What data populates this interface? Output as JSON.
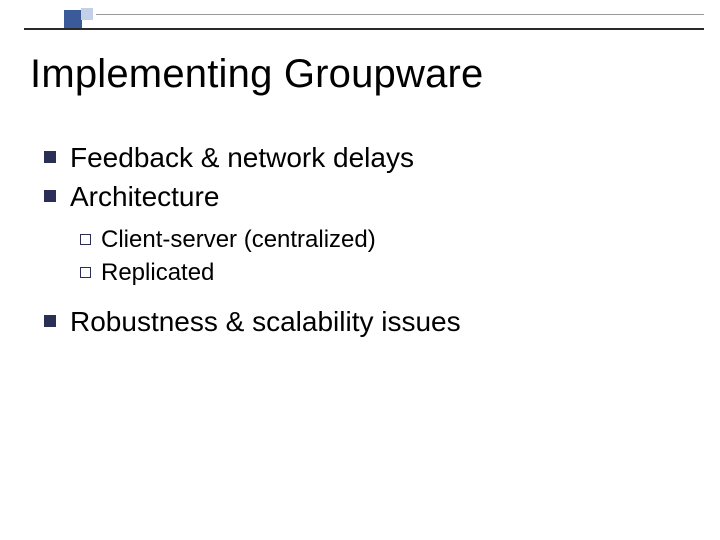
{
  "title": "Implementing Groupware",
  "bullets": {
    "item1": "Feedback & network delays",
    "item2": "Architecture",
    "sub1": "Client-server (centralized)",
    "sub2": "Replicated",
    "item3": "Robustness & scalability issues"
  }
}
